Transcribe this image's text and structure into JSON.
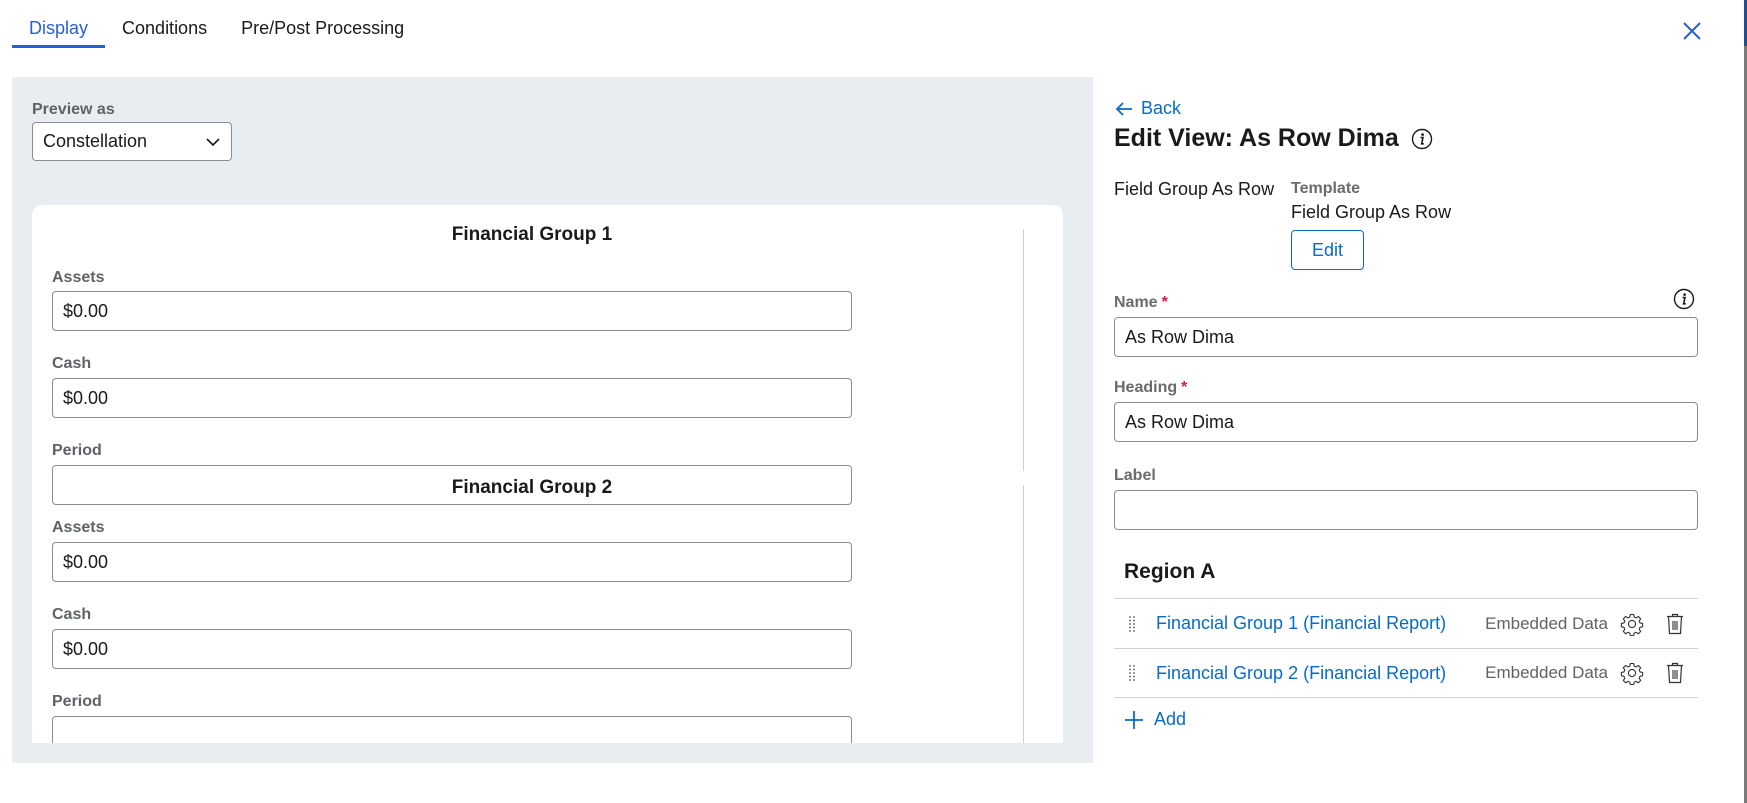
{
  "tabs": [
    {
      "label": "Display",
      "active": true
    },
    {
      "label": "Conditions",
      "active": false
    },
    {
      "label": "Pre/Post Processing",
      "active": false
    }
  ],
  "close_icon": "close-icon",
  "colors": {
    "accent": "#295ed9",
    "link": "#076bc9",
    "required": "#d1203a",
    "preview_bg": "#e8edf1"
  },
  "preview": {
    "label": "Preview as",
    "selected": "Constellation",
    "groups": [
      {
        "title": "Financial Group 1",
        "fields": [
          {
            "label": "Assets",
            "value": "$0.00"
          },
          {
            "label": "Cash",
            "value": "$0.00"
          },
          {
            "label": "Period",
            "value": ""
          }
        ]
      },
      {
        "title": "Financial Group 2",
        "fields": [
          {
            "label": "Assets",
            "value": "$0.00"
          },
          {
            "label": "Cash",
            "value": "$0.00"
          },
          {
            "label": "Period",
            "value": ""
          }
        ]
      }
    ]
  },
  "editor": {
    "back_label": "Back",
    "title": "Edit View: As Row Dima",
    "field_group_name": "Field Group As Row",
    "template_label": "Template",
    "template_value": "Field Group As Row",
    "edit_label": "Edit",
    "name_label": "Name",
    "name_value": "As Row Dima",
    "heading_label": "Heading",
    "heading_value": "As Row Dima",
    "label_label": "Label",
    "label_value": "",
    "required_mark": "*",
    "region": {
      "title": "Region A",
      "items": [
        {
          "label": "Financial Group 1 (Financial Report)",
          "type": "Embedded Data"
        },
        {
          "label": "Financial Group 2 (Financial Report)",
          "type": "Embedded Data"
        }
      ],
      "add_label": "Add"
    }
  }
}
